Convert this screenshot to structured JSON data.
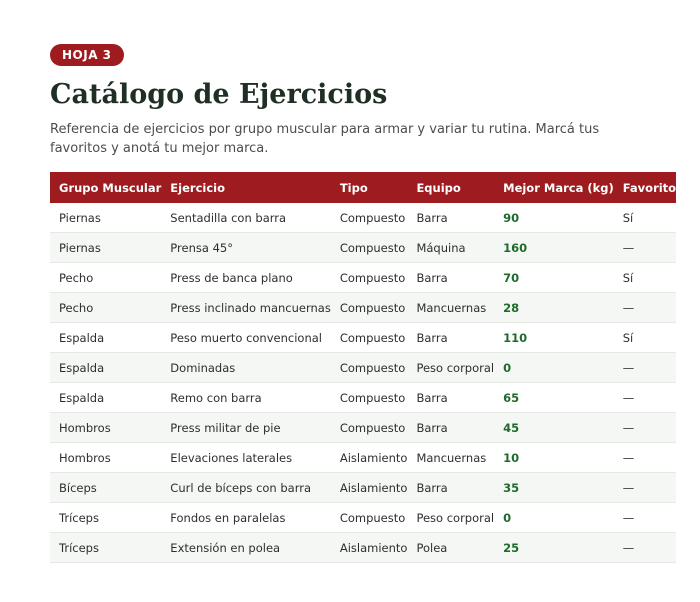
{
  "badge": "HOJA 3",
  "title": "Catálogo de Ejercicios",
  "subtitle": "Referencia de ejercicios por grupo muscular para armar y variar tu rutina. Marcá tus favoritos y anotá tu mejor marca.",
  "table": {
    "headers": [
      "Grupo Muscular",
      "Ejercicio",
      "Tipo",
      "Equipo",
      "Mejor Marca (kg)",
      "Favorito"
    ],
    "rows": [
      [
        "Piernas",
        "Sentadilla con barra",
        "Compuesto",
        "Barra",
        "90",
        "Sí"
      ],
      [
        "Piernas",
        "Prensa 45°",
        "Compuesto",
        "Máquina",
        "160",
        "—"
      ],
      [
        "Pecho",
        "Press de banca plano",
        "Compuesto",
        "Barra",
        "70",
        "Sí"
      ],
      [
        "Pecho",
        "Press inclinado mancuernas",
        "Compuesto",
        "Mancuernas",
        "28",
        "—"
      ],
      [
        "Espalda",
        "Peso muerto convencional",
        "Compuesto",
        "Barra",
        "110",
        "Sí"
      ],
      [
        "Espalda",
        "Dominadas",
        "Compuesto",
        "Peso corporal",
        "0",
        "—"
      ],
      [
        "Espalda",
        "Remo con barra",
        "Compuesto",
        "Barra",
        "65",
        "—"
      ],
      [
        "Hombros",
        "Press militar de pie",
        "Compuesto",
        "Barra",
        "45",
        "—"
      ],
      [
        "Hombros",
        "Elevaciones laterales",
        "Aislamiento",
        "Mancuernas",
        "10",
        "—"
      ],
      [
        "Bíceps",
        "Curl de bíceps con barra",
        "Aislamiento",
        "Barra",
        "35",
        "—"
      ],
      [
        "Tríceps",
        "Fondos en paralelas",
        "Compuesto",
        "Peso corporal",
        "0",
        "—"
      ],
      [
        "Tríceps",
        "Extensión en polea",
        "Aislamiento",
        "Polea",
        "25",
        "—"
      ]
    ]
  },
  "colors": {
    "accent": "#9e1b1f",
    "title": "#1f2f24",
    "value": "#1f6b2a"
  }
}
